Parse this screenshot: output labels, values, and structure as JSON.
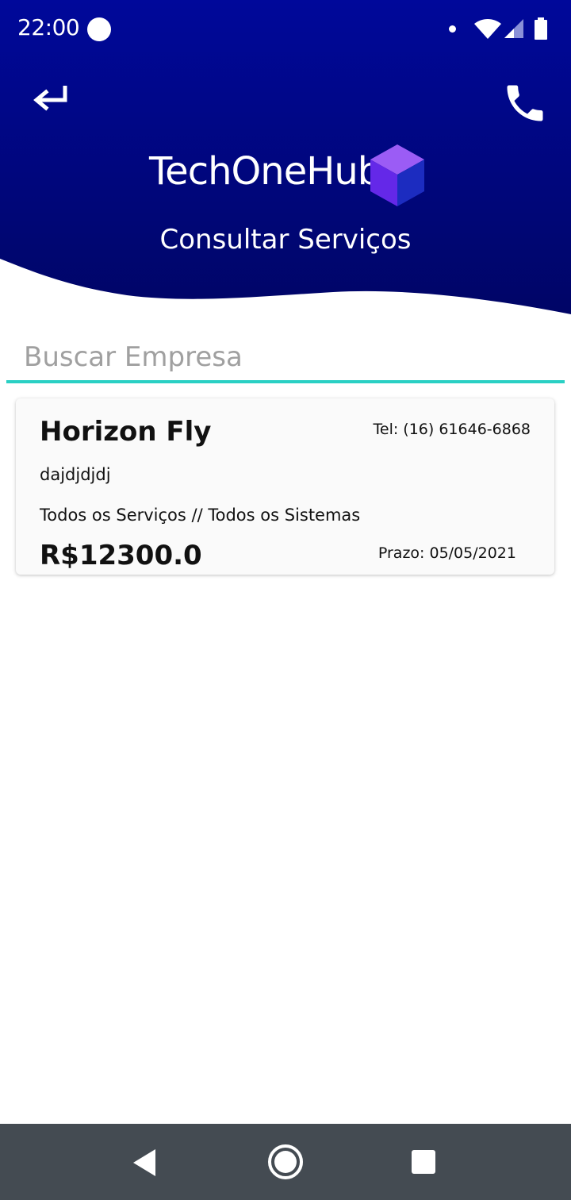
{
  "status_bar": {
    "time": "22:00"
  },
  "header": {
    "app_title": "TechOneHub",
    "page_title": "Consultar Serviços",
    "colors": {
      "gradient_top": "#00089a",
      "gradient_bottom": "#000566"
    }
  },
  "search": {
    "placeholder": "Buscar Empresa",
    "value": "",
    "accent_color": "#2ad0c4"
  },
  "services": [
    {
      "company": "Horizon Fly",
      "phone": "Tel: (16) 61646-6868",
      "description": "dajdjdjdj",
      "services": "Todos os Serviços // Todos os Sistemas",
      "price": "R$12300.0",
      "deadline": "Prazo: 05/05/2021"
    }
  ],
  "icons": {
    "back": "back-arrow-icon",
    "phone": "phone-icon",
    "logo": "cube-logo-icon",
    "wifi": "wifi-icon",
    "signal": "signal-icon",
    "battery": "battery-icon",
    "nav_back": "nav-back-icon",
    "nav_home": "nav-home-icon",
    "nav_recents": "nav-recents-icon"
  }
}
